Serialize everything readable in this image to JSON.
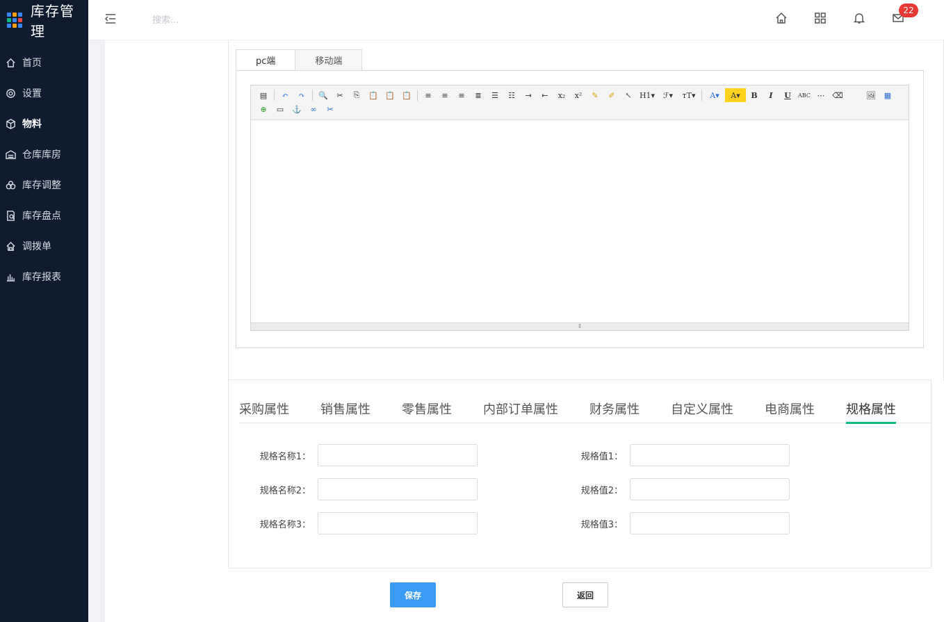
{
  "brand": {
    "title": "库存管理"
  },
  "sidebar": {
    "items": [
      {
        "label": "首页",
        "icon": "home-icon"
      },
      {
        "label": "设置",
        "icon": "gear-icon"
      },
      {
        "label": "物料",
        "icon": "cube-icon",
        "active": true
      },
      {
        "label": "仓库库房",
        "icon": "warehouse-icon"
      },
      {
        "label": "库存调整",
        "icon": "adjust-icon"
      },
      {
        "label": "库存盘点",
        "icon": "check-icon"
      },
      {
        "label": "调拨单",
        "icon": "transfer-icon"
      },
      {
        "label": "库存报表",
        "icon": "chart-icon"
      }
    ]
  },
  "header": {
    "search_placeholder": "搜索...",
    "mail_badge": "22"
  },
  "editor": {
    "tabs": [
      "pc端",
      "移动端"
    ],
    "active_tab": "pc端",
    "toolbar_text": {
      "h1": "H1▾",
      "font": "ℱ▾",
      "size": "тT▾",
      "color": "A▾",
      "bg": "A▾",
      "bold": "B",
      "italic": "I",
      "underline": "U",
      "strike": "ABC",
      "sub": "x₂",
      "sup": "x²"
    }
  },
  "attr_tabs": [
    "采购属性",
    "销售属性",
    "零售属性",
    "内部订单属性",
    "财务属性",
    "自定义属性",
    "电商属性",
    "规格属性"
  ],
  "active_attr_tab": "规格属性",
  "spec": {
    "names": [
      "规格名称1：",
      "规格名称2：",
      "规格名称3："
    ],
    "values": [
      "规格值1：",
      "规格值2：",
      "规格值3："
    ]
  },
  "buttons": {
    "save": "保存",
    "back": "返回"
  },
  "colors": {
    "sidebar": "#0f1c30",
    "accent": "#12b886",
    "primary": "#3a9cf5",
    "badge": "#e53935"
  }
}
